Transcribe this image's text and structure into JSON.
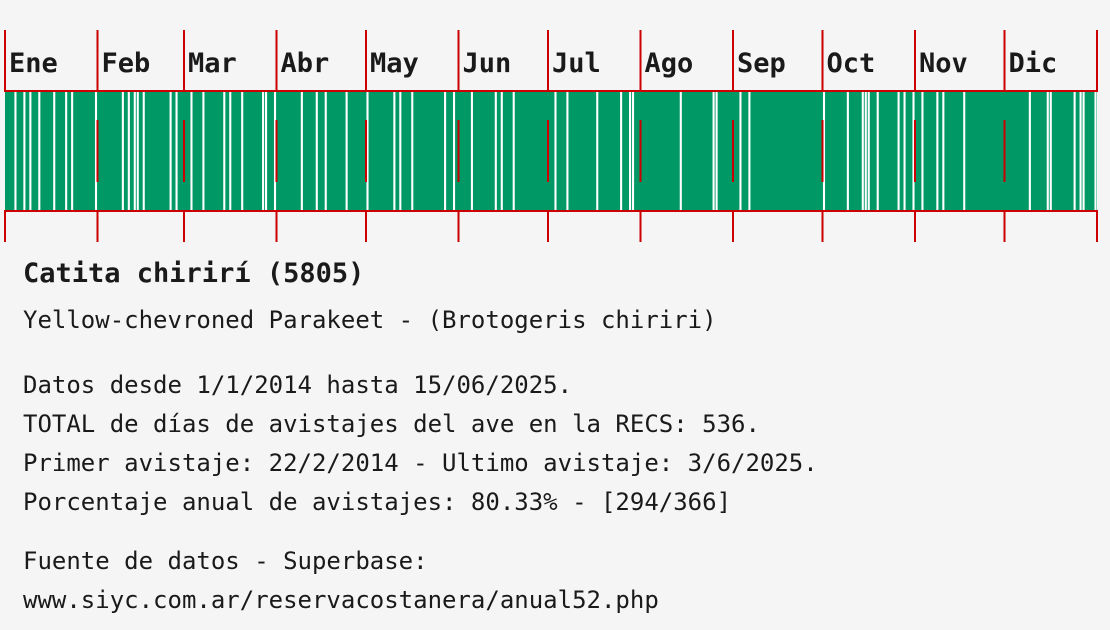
{
  "colors": {
    "bar": "#009966",
    "gap": "#ffffff",
    "grid": "#cc0000",
    "background": "#f5f5f5",
    "text": "#1a1a1a"
  },
  "chart_data": {
    "type": "heatmap",
    "description_note": "",
    "months": [
      {
        "label": "Ene",
        "days": 31
      },
      {
        "label": "Feb",
        "days": 29
      },
      {
        "label": "Mar",
        "days": 31
      },
      {
        "label": "Abr",
        "days": 30
      },
      {
        "label": "May",
        "days": 31
      },
      {
        "label": "Jun",
        "days": 30
      },
      {
        "label": "Jul",
        "days": 31
      },
      {
        "label": "Ago",
        "days": 31
      },
      {
        "label": "Sep",
        "days": 30
      },
      {
        "label": "Oct",
        "days": 31
      },
      {
        "label": "Nov",
        "days": 30
      },
      {
        "label": "Dic",
        "days": 31
      }
    ],
    "days_without_sighting": [
      4,
      7,
      9,
      12,
      17,
      21,
      23,
      31,
      40,
      42,
      44,
      45,
      47,
      56,
      58,
      63,
      67,
      74,
      76,
      80,
      87,
      88,
      91,
      100,
      105,
      108,
      115,
      122,
      131,
      133,
      137,
      148,
      151,
      157,
      165,
      167,
      171,
      185,
      189,
      199,
      207,
      210,
      211,
      227,
      238,
      239,
      247,
      250,
      275,
      288,
      289,
      290,
      300,
      302,
      305,
      308,
      313,
      315,
      322,
      344,
      350,
      351,
      359,
      361,
      362,
      366,
      283,
      293
    ],
    "sighted_days": 294,
    "total_days": 366
  },
  "species": {
    "title": "Catita chirirí (5805)",
    "subtitle": "Yellow-chevroned Parakeet - (Brotogeris chiriri)"
  },
  "stats": {
    "range": "Datos desde 1/1/2014 hasta 15/06/2025.",
    "total": "TOTAL de días de avistajes del ave en la RECS: 536.",
    "first_last": "Primer avistaje: 22/2/2014 - Ultimo avistaje: 3/6/2025.",
    "percent": "Porcentaje anual de avistajes: 80.33% - [294/366]"
  },
  "source": {
    "label": "Fuente de datos - Superbase:",
    "url": "www.siyc.com.ar/reservacostanera/anual52.php"
  }
}
